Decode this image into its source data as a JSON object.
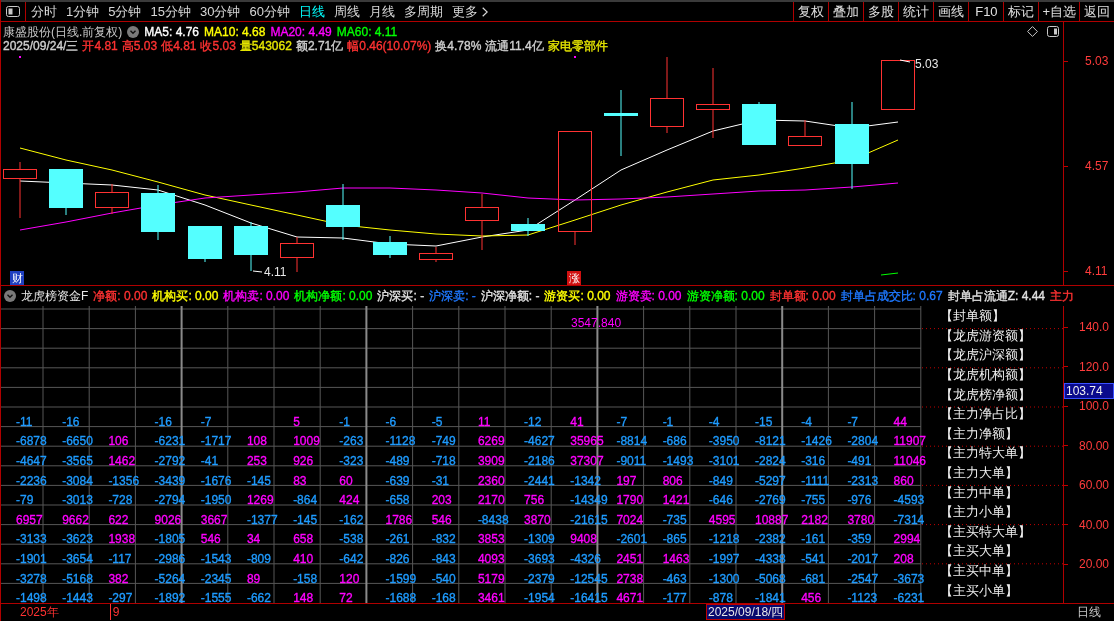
{
  "toolbar": {
    "periods": [
      {
        "label": "分时",
        "kind": "period",
        "selected": false
      },
      {
        "label": "1分钟",
        "kind": "period",
        "selected": false
      },
      {
        "label": "5分钟",
        "kind": "period",
        "selected": false
      },
      {
        "label": "15分钟",
        "kind": "period",
        "selected": false
      },
      {
        "label": "30分钟",
        "kind": "period",
        "selected": false
      },
      {
        "label": "60分钟",
        "kind": "period",
        "selected": false
      },
      {
        "label": "日线",
        "kind": "period",
        "selected": true
      },
      {
        "label": "周线",
        "kind": "period",
        "selected": false
      },
      {
        "label": "月线",
        "kind": "period",
        "selected": false
      },
      {
        "label": "多周期",
        "kind": "period",
        "selected": false
      },
      {
        "label": "更多",
        "kind": "menu",
        "selected": false
      }
    ],
    "buttons": [
      "复权",
      "叠加",
      "多股",
      "统计",
      "画线",
      "F10",
      "标记",
      "+自选",
      "返回"
    ]
  },
  "stock_info": {
    "title": "康盛股份(日线.前复权)",
    "moving_averages": [
      {
        "label": "MA5: 4.76",
        "color": "#ffffff"
      },
      {
        "label": "MA10: 4.68",
        "color": "#ffff00"
      },
      {
        "label": "MA20: 4.49",
        "color": "#ff00ff"
      },
      {
        "label": "MA60: 4.11",
        "color": "#00ff00"
      }
    ],
    "quote": [
      {
        "text": "2025/09/24/三",
        "color": "#d0d0d0"
      },
      {
        "text": "开4.81",
        "color": "#ff3232"
      },
      {
        "text": "高5.03",
        "color": "#ff3232"
      },
      {
        "text": "低4.81",
        "color": "#ff3232"
      },
      {
        "text": "收5.03",
        "color": "#ff3232"
      },
      {
        "text": "量543062",
        "color": "#e6e600"
      },
      {
        "text": "额2.71亿",
        "color": "#d0d0d0"
      },
      {
        "text": "幅0.46(10.07%)",
        "color": "#ff3232"
      },
      {
        "text": "换4.78%",
        "color": "#d0d0d0"
      },
      {
        "text": "流通11.4亿",
        "color": "#d0d0d0"
      },
      {
        "text": "家电零部件",
        "color": "#e6e600"
      }
    ]
  },
  "price_chart": {
    "axis_labels": [
      "5.03",
      "4.57",
      "4.11"
    ],
    "high_label": "5.03",
    "low_label": "4.11",
    "markers": [
      {
        "text": "财",
        "color": "#2040c0"
      },
      {
        "text": "涨",
        "color": "#d01010"
      }
    ]
  },
  "indicator": {
    "title": "龙虎榜资金F",
    "readings": [
      {
        "text": "净额: 0.00",
        "color": "#ff3232"
      },
      {
        "text": "机构买: 0.00",
        "color": "#ffff00"
      },
      {
        "text": "机构卖: 0.00",
        "color": "#ff00ff"
      },
      {
        "text": "机构净额: 0.00",
        "color": "#00ff00"
      },
      {
        "text": "沪深买: -",
        "color": "#e0e0e0"
      },
      {
        "text": "沪深卖: -",
        "color": "#1e78ff"
      },
      {
        "text": "沪深净额: -",
        "color": "#e0e0e0"
      },
      {
        "text": "游资买: 0.00",
        "color": "#ffff00"
      },
      {
        "text": "游资卖: 0.00",
        "color": "#ff00ff"
      },
      {
        "text": "游资净额: 0.00",
        "color": "#00ff00"
      },
      {
        "text": "封单额: 0.00",
        "color": "#ff3232"
      },
      {
        "text": "封单占成交比: 0.67",
        "color": "#1e78ff"
      },
      {
        "text": "封单占流通Z: 4.44",
        "color": "#e0e0e0"
      },
      {
        "text": "主力",
        "color": "#ff3232"
      }
    ],
    "top_value": "3547.840",
    "rows": [
      [
        {
          "text": "-11",
          "color": "#1e9bff"
        },
        {
          "text": "-16",
          "color": "#1e9bff"
        },
        null,
        {
          "text": "-16",
          "color": "#1e9bff"
        },
        {
          "text": "-7",
          "color": "#1e9bff"
        },
        null,
        {
          "text": "5",
          "color": "#ff00ff"
        },
        {
          "text": "-1",
          "color": "#1e9bff"
        },
        {
          "text": "-6",
          "color": "#1e9bff"
        },
        {
          "text": "-5",
          "color": "#1e9bff"
        },
        {
          "text": "11",
          "color": "#ff00ff"
        },
        {
          "text": "-12",
          "color": "#1e9bff"
        },
        {
          "text": "41",
          "color": "#ff00ff"
        },
        {
          "text": "-7",
          "color": "#1e9bff"
        },
        {
          "text": "-1",
          "color": "#1e9bff"
        },
        {
          "text": "-4",
          "color": "#1e9bff"
        },
        {
          "text": "-15",
          "color": "#1e9bff"
        },
        {
          "text": "-4",
          "color": "#1e9bff"
        },
        {
          "text": "-7",
          "color": "#1e9bff"
        },
        {
          "text": "44",
          "color": "#ff00ff"
        }
      ],
      [
        {
          "text": "-6878",
          "color": "#1e9bff"
        },
        {
          "text": "-6650",
          "color": "#1e9bff"
        },
        {
          "text": "106",
          "color": "#ff00ff"
        },
        {
          "text": "-6231",
          "color": "#1e9bff"
        },
        {
          "text": "-1717",
          "color": "#1e9bff"
        },
        {
          "text": "108",
          "color": "#ff00ff"
        },
        {
          "text": "1009",
          "color": "#ff00ff"
        },
        {
          "text": "-263",
          "color": "#1e9bff"
        },
        {
          "text": "-1128",
          "color": "#1e9bff"
        },
        {
          "text": "-749",
          "color": "#1e9bff"
        },
        {
          "text": "6269",
          "color": "#ff00ff"
        },
        {
          "text": "-4627",
          "color": "#1e9bff"
        },
        {
          "text": "35965",
          "color": "#ff00ff"
        },
        {
          "text": "-8814",
          "color": "#1e9bff"
        },
        {
          "text": "-686",
          "color": "#1e9bff"
        },
        {
          "text": "-3950",
          "color": "#1e9bff"
        },
        {
          "text": "-8121",
          "color": "#1e9bff"
        },
        {
          "text": "-1426",
          "color": "#1e9bff"
        },
        {
          "text": "-2804",
          "color": "#1e9bff"
        },
        {
          "text": "11907",
          "color": "#ff00ff"
        }
      ],
      [
        {
          "text": "-4647",
          "color": "#1e9bff"
        },
        {
          "text": "-3565",
          "color": "#1e9bff"
        },
        {
          "text": "1462",
          "color": "#ff00ff"
        },
        {
          "text": "-2792",
          "color": "#1e9bff"
        },
        {
          "text": "-41",
          "color": "#1e9bff"
        },
        {
          "text": "253",
          "color": "#ff00ff"
        },
        {
          "text": "926",
          "color": "#ff00ff"
        },
        {
          "text": "-323",
          "color": "#1e9bff"
        },
        {
          "text": "-489",
          "color": "#1e9bff"
        },
        {
          "text": "-718",
          "color": "#1e9bff"
        },
        {
          "text": "3909",
          "color": "#ff00ff"
        },
        {
          "text": "-2186",
          "color": "#1e9bff"
        },
        {
          "text": "37307",
          "color": "#ff00ff"
        },
        {
          "text": "-9011",
          "color": "#1e9bff"
        },
        {
          "text": "-1493",
          "color": "#1e9bff"
        },
        {
          "text": "-3101",
          "color": "#1e9bff"
        },
        {
          "text": "-2824",
          "color": "#1e9bff"
        },
        {
          "text": "-316",
          "color": "#1e9bff"
        },
        {
          "text": "-491",
          "color": "#1e9bff"
        },
        {
          "text": "11046",
          "color": "#ff00ff"
        }
      ],
      [
        {
          "text": "-2236",
          "color": "#1e9bff"
        },
        {
          "text": "-3084",
          "color": "#1e9bff"
        },
        {
          "text": "-1356",
          "color": "#1e9bff"
        },
        {
          "text": "-3439",
          "color": "#1e9bff"
        },
        {
          "text": "-1676",
          "color": "#1e9bff"
        },
        {
          "text": "-145",
          "color": "#1e9bff"
        },
        {
          "text": "83",
          "color": "#ff00ff"
        },
        {
          "text": "60",
          "color": "#ff00ff"
        },
        {
          "text": "-639",
          "color": "#1e9bff"
        },
        {
          "text": "-31",
          "color": "#1e9bff"
        },
        {
          "text": "2360",
          "color": "#ff00ff"
        },
        {
          "text": "-2441",
          "color": "#1e9bff"
        },
        {
          "text": "-1342",
          "color": "#1e9bff"
        },
        {
          "text": "197",
          "color": "#ff00ff"
        },
        {
          "text": "806",
          "color": "#ff00ff"
        },
        {
          "text": "-849",
          "color": "#1e9bff"
        },
        {
          "text": "-5297",
          "color": "#1e9bff"
        },
        {
          "text": "-1111",
          "color": "#1e9bff"
        },
        {
          "text": "-2313",
          "color": "#1e9bff"
        },
        {
          "text": "860",
          "color": "#ff00ff"
        }
      ],
      [
        {
          "text": "-79",
          "color": "#1e9bff"
        },
        {
          "text": "-3013",
          "color": "#1e9bff"
        },
        {
          "text": "-728",
          "color": "#1e9bff"
        },
        {
          "text": "-2794",
          "color": "#1e9bff"
        },
        {
          "text": "-1950",
          "color": "#1e9bff"
        },
        {
          "text": "1269",
          "color": "#ff00ff"
        },
        {
          "text": "-864",
          "color": "#1e9bff"
        },
        {
          "text": "424",
          "color": "#ff00ff"
        },
        {
          "text": "-658",
          "color": "#1e9bff"
        },
        {
          "text": "203",
          "color": "#ff00ff"
        },
        {
          "text": "2170",
          "color": "#ff00ff"
        },
        {
          "text": "756",
          "color": "#ff00ff"
        },
        {
          "text": "-14349",
          "color": "#1e9bff"
        },
        {
          "text": "1790",
          "color": "#ff00ff"
        },
        {
          "text": "1421",
          "color": "#ff00ff"
        },
        {
          "text": "-646",
          "color": "#1e9bff"
        },
        {
          "text": "-2769",
          "color": "#1e9bff"
        },
        {
          "text": "-755",
          "color": "#1e9bff"
        },
        {
          "text": "-976",
          "color": "#1e9bff"
        },
        {
          "text": "-4593",
          "color": "#1e9bff"
        }
      ],
      [
        {
          "text": "6957",
          "color": "#ff00ff"
        },
        {
          "text": "9662",
          "color": "#ff00ff"
        },
        {
          "text": "622",
          "color": "#ff00ff"
        },
        {
          "text": "9026",
          "color": "#ff00ff"
        },
        {
          "text": "3667",
          "color": "#ff00ff"
        },
        {
          "text": "-1377",
          "color": "#1e9bff"
        },
        {
          "text": "-145",
          "color": "#1e9bff"
        },
        {
          "text": "-162",
          "color": "#1e9bff"
        },
        {
          "text": "1786",
          "color": "#ff00ff"
        },
        {
          "text": "546",
          "color": "#ff00ff"
        },
        {
          "text": "-8438",
          "color": "#1e9bff"
        },
        {
          "text": "3870",
          "color": "#ff00ff"
        },
        {
          "text": "-21615",
          "color": "#1e9bff"
        },
        {
          "text": "7024",
          "color": "#ff00ff"
        },
        {
          "text": "-735",
          "color": "#1e9bff"
        },
        {
          "text": "4595",
          "color": "#ff00ff"
        },
        {
          "text": "10887",
          "color": "#ff00ff"
        },
        {
          "text": "2182",
          "color": "#ff00ff"
        },
        {
          "text": "3780",
          "color": "#ff00ff"
        },
        {
          "text": "-7314",
          "color": "#1e9bff"
        }
      ],
      [
        {
          "text": "-3133",
          "color": "#1e9bff"
        },
        {
          "text": "-3623",
          "color": "#1e9bff"
        },
        {
          "text": "1938",
          "color": "#ff00ff"
        },
        {
          "text": "-1805",
          "color": "#1e9bff"
        },
        {
          "text": "546",
          "color": "#ff00ff"
        },
        {
          "text": "34",
          "color": "#ff00ff"
        },
        {
          "text": "658",
          "color": "#ff00ff"
        },
        {
          "text": "-538",
          "color": "#1e9bff"
        },
        {
          "text": "-261",
          "color": "#1e9bff"
        },
        {
          "text": "-832",
          "color": "#1e9bff"
        },
        {
          "text": "3853",
          "color": "#ff00ff"
        },
        {
          "text": "-1309",
          "color": "#1e9bff"
        },
        {
          "text": "9408",
          "color": "#ff00ff"
        },
        {
          "text": "-2601",
          "color": "#1e9bff"
        },
        {
          "text": "-865",
          "color": "#1e9bff"
        },
        {
          "text": "-1218",
          "color": "#1e9bff"
        },
        {
          "text": "-2382",
          "color": "#1e9bff"
        },
        {
          "text": "-161",
          "color": "#1e9bff"
        },
        {
          "text": "-359",
          "color": "#1e9bff"
        },
        {
          "text": "2994",
          "color": "#ff00ff"
        }
      ],
      [
        {
          "text": "-1901",
          "color": "#1e9bff"
        },
        {
          "text": "-3654",
          "color": "#1e9bff"
        },
        {
          "text": "-117",
          "color": "#1e9bff"
        },
        {
          "text": "-2986",
          "color": "#1e9bff"
        },
        {
          "text": "-1543",
          "color": "#1e9bff"
        },
        {
          "text": "-809",
          "color": "#1e9bff"
        },
        {
          "text": "410",
          "color": "#ff00ff"
        },
        {
          "text": "-642",
          "color": "#1e9bff"
        },
        {
          "text": "-826",
          "color": "#1e9bff"
        },
        {
          "text": "-843",
          "color": "#1e9bff"
        },
        {
          "text": "4093",
          "color": "#ff00ff"
        },
        {
          "text": "-3693",
          "color": "#1e9bff"
        },
        {
          "text": "-4326",
          "color": "#1e9bff"
        },
        {
          "text": "2451",
          "color": "#ff00ff"
        },
        {
          "text": "1463",
          "color": "#ff00ff"
        },
        {
          "text": "-1997",
          "color": "#1e9bff"
        },
        {
          "text": "-4338",
          "color": "#1e9bff"
        },
        {
          "text": "-541",
          "color": "#1e9bff"
        },
        {
          "text": "-2017",
          "color": "#1e9bff"
        },
        {
          "text": "208",
          "color": "#ff00ff"
        }
      ],
      [
        {
          "text": "-3278",
          "color": "#1e9bff"
        },
        {
          "text": "-5168",
          "color": "#1e9bff"
        },
        {
          "text": "382",
          "color": "#ff00ff"
        },
        {
          "text": "-5264",
          "color": "#1e9bff"
        },
        {
          "text": "-2345",
          "color": "#1e9bff"
        },
        {
          "text": "89",
          "color": "#ff00ff"
        },
        {
          "text": "-158",
          "color": "#1e9bff"
        },
        {
          "text": "120",
          "color": "#ff00ff"
        },
        {
          "text": "-1599",
          "color": "#1e9bff"
        },
        {
          "text": "-540",
          "color": "#1e9bff"
        },
        {
          "text": "5179",
          "color": "#ff00ff"
        },
        {
          "text": "-2379",
          "color": "#1e9bff"
        },
        {
          "text": "-12545",
          "color": "#1e9bff"
        },
        {
          "text": "2738",
          "color": "#ff00ff"
        },
        {
          "text": "-463",
          "color": "#1e9bff"
        },
        {
          "text": "-1300",
          "color": "#1e9bff"
        },
        {
          "text": "-5068",
          "color": "#1e9bff"
        },
        {
          "text": "-681",
          "color": "#1e9bff"
        },
        {
          "text": "-2547",
          "color": "#1e9bff"
        },
        {
          "text": "-3673",
          "color": "#1e9bff"
        }
      ],
      [
        {
          "text": "-1498",
          "color": "#1e9bff"
        },
        {
          "text": "-1443",
          "color": "#1e9bff"
        },
        {
          "text": "-297",
          "color": "#1e9bff"
        },
        {
          "text": "-1892",
          "color": "#1e9bff"
        },
        {
          "text": "-1555",
          "color": "#1e9bff"
        },
        {
          "text": "-662",
          "color": "#1e9bff"
        },
        {
          "text": "148",
          "color": "#ff00ff"
        },
        {
          "text": "72",
          "color": "#ff00ff"
        },
        {
          "text": "-1688",
          "color": "#1e9bff"
        },
        {
          "text": "-168",
          "color": "#1e9bff"
        },
        {
          "text": "3461",
          "color": "#ff00ff"
        },
        {
          "text": "-1954",
          "color": "#1e9bff"
        },
        {
          "text": "-16415",
          "color": "#1e9bff"
        },
        {
          "text": "4671",
          "color": "#ff00ff"
        },
        {
          "text": "-177",
          "color": "#1e9bff"
        },
        {
          "text": "-878",
          "color": "#1e9bff"
        },
        {
          "text": "-1841",
          "color": "#1e9bff"
        },
        {
          "text": "456",
          "color": "#ff00ff"
        },
        {
          "text": "-1123",
          "color": "#1e9bff"
        },
        {
          "text": "-6231",
          "color": "#1e9bff"
        }
      ]
    ],
    "legend": [
      "【封单额】",
      "【龙虎游资额】",
      "【龙虎沪深额】",
      "【龙虎机构额】",
      "【龙虎榜净额】",
      "【主力净占比】",
      "【主力净额】",
      "【主力特大单】",
      "【主力大单】",
      "【主力中单】",
      "【主力小单】",
      "【主买特大单】",
      "【主买大单】",
      "【主买中单】",
      "【主买小单】"
    ],
    "axis_labels": [
      "140.0",
      "120.0",
      "100.0",
      "80.00",
      "60.00",
      "40.00",
      "20.00"
    ],
    "current_value": "103.74"
  },
  "time_axis": {
    "year": "2025年",
    "month": "9",
    "cursor_date": "2025/09/18/四",
    "period": "日线"
  }
}
